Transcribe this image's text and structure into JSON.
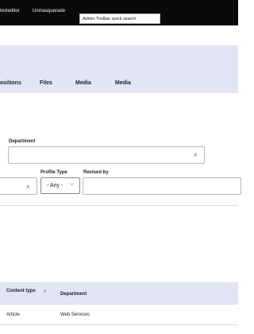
{
  "toolbar": {
    "user_label": "testeditor",
    "unmasquerade_label": "Unmasquerade",
    "search_value": "Admin Toolbar quick search"
  },
  "tabs": [
    {
      "label": "ositions"
    },
    {
      "label": "Files"
    },
    {
      "label": "Media"
    },
    {
      "label": "Media"
    }
  ],
  "filters": {
    "department_label": "Department",
    "profile_type_label": "Profile Type",
    "profile_type_value": "- Any -",
    "revised_by_label": "Revised by"
  },
  "icons": {
    "search": "search-icon",
    "chevron": "chevron-down-icon",
    "sort": "sort-icon"
  },
  "table": {
    "headers": [
      "Content type",
      "Department"
    ],
    "rows": [
      {
        "content_type": "Article",
        "department": "Web Services"
      }
    ]
  }
}
